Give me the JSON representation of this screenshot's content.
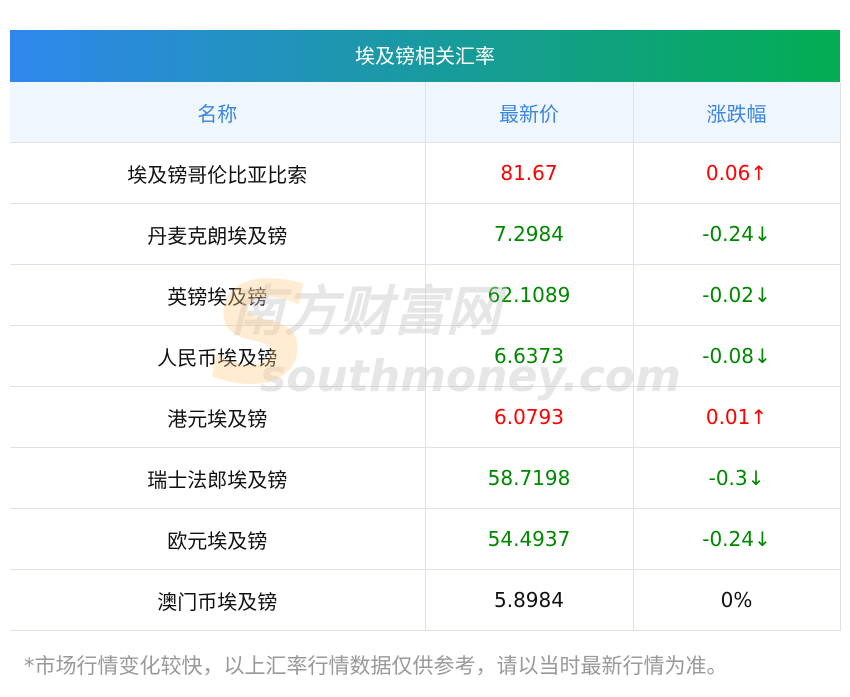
{
  "title": "埃及镑相关汇率",
  "headers": [
    "名称",
    "最新价",
    "涨跌幅"
  ],
  "rows": [
    {
      "name": "埃及镑哥伦比亚比索",
      "price": "81.67",
      "change": "0.06↑",
      "dir": "up"
    },
    {
      "name": "丹麦克朗埃及镑",
      "price": "7.2984",
      "change": "-0.24↓",
      "dir": "down"
    },
    {
      "name": "英镑埃及镑",
      "price": "62.1089",
      "change": "-0.02↓",
      "dir": "down"
    },
    {
      "name": "人民币埃及镑",
      "price": "6.6373",
      "change": "-0.08↓",
      "dir": "down"
    },
    {
      "name": "港元埃及镑",
      "price": "6.0793",
      "change": "0.01↑",
      "dir": "up"
    },
    {
      "name": "瑞士法郎埃及镑",
      "price": "58.7198",
      "change": "-0.3↓",
      "dir": "down"
    },
    {
      "name": "欧元埃及镑",
      "price": "54.4937",
      "change": "-0.24↓",
      "dir": "down"
    },
    {
      "name": "澳门币埃及镑",
      "price": "5.8984",
      "change": "0%",
      "dir": "flat"
    }
  ],
  "note": "*市场行情变化较快，以上汇率行情数据仅供参考，请以当时最新行情为准。",
  "watermark": {
    "cn": "南方财富网",
    "en": "southmoney.com"
  },
  "colors": {
    "up": "#ff0000",
    "down": "#008800",
    "header_text": "#3b86e0",
    "gradient_start": "#2f87ee",
    "gradient_end": "#03ad52"
  }
}
